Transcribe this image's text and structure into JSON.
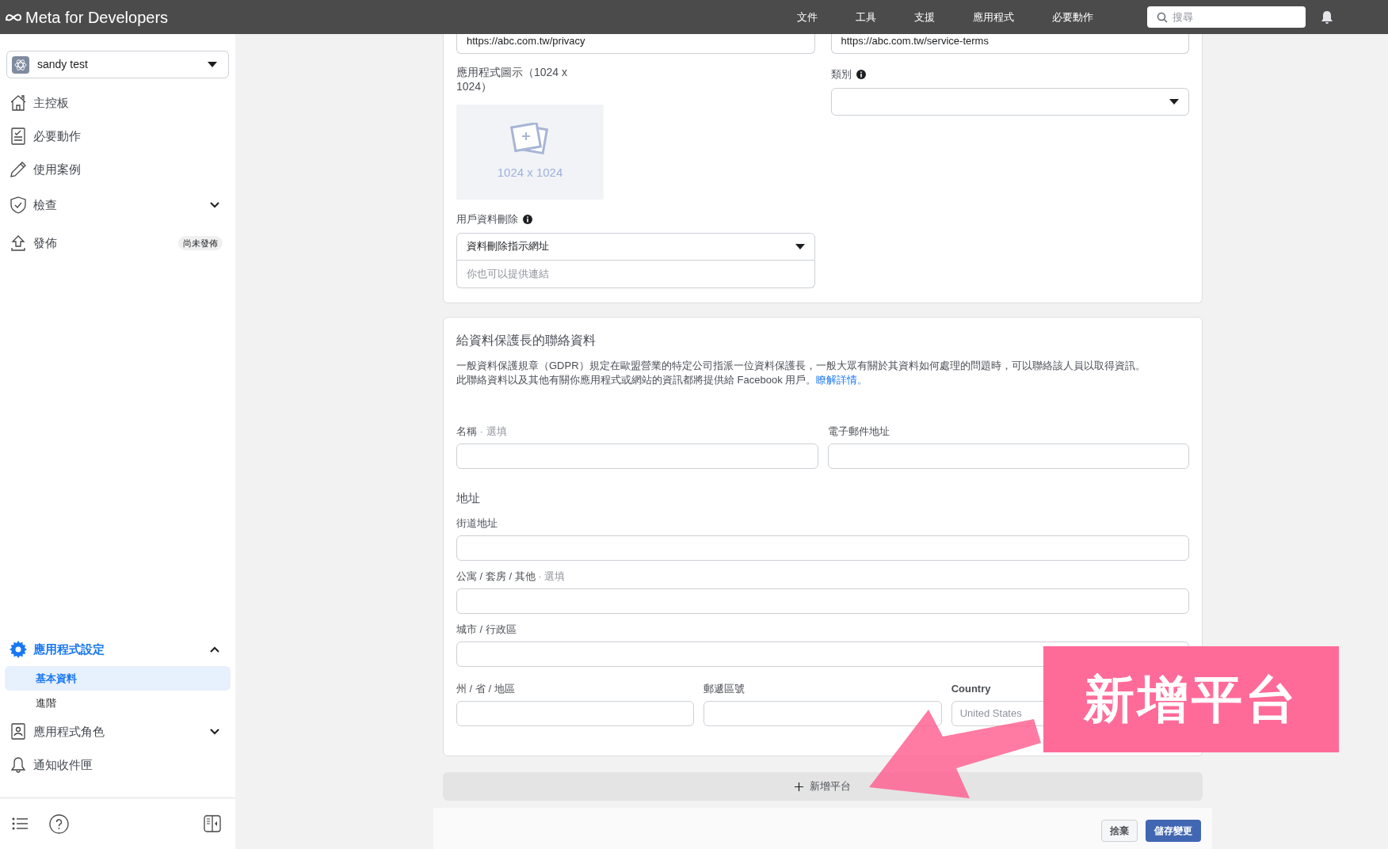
{
  "top_bar": {
    "logo": "Meta for Developers",
    "nav": [
      "文件",
      "工具",
      "支援",
      "應用程式",
      "必要動作"
    ],
    "search": {
      "placeholder": "搜尋"
    }
  },
  "sidebar": {
    "app_selector": "sandy test",
    "items": [
      {
        "label": "主控板",
        "selected": false
      },
      {
        "label": "必要動作",
        "selected": false
      },
      {
        "label": "使用案例",
        "selected": false
      },
      {
        "label": "檢查",
        "selected": false,
        "expanded": false
      },
      {
        "label": "發佈",
        "selected": false,
        "badge": "尚未發佈"
      }
    ],
    "bottom_items": [
      {
        "label": "應用程式設定",
        "selected": true,
        "expanded": true,
        "children": [
          {
            "label": "基本資料",
            "selected": true
          },
          {
            "label": "進階",
            "selected": false
          }
        ]
      },
      {
        "label": "應用程式角色",
        "selected": false,
        "expanded": false
      },
      {
        "label": "通知收件匣",
        "selected": false
      }
    ]
  },
  "basic_card": {
    "privacy_url": "https://abc.com.tw/privacy",
    "terms_url": "https://abc.com.tw/service-terms",
    "app_icon": {
      "label": "應用程式圖示（1024 x 1024）",
      "hint": "1024 x 1024"
    },
    "category": {
      "label": "類別"
    },
    "data_deletion": {
      "label": "用戶資料刪除",
      "select_value": "資料刪除指示網址",
      "url_placeholder": "你也可以提供連結"
    }
  },
  "dpo_card": {
    "title": "給資料保護長的聯絡資料",
    "paragraphs": [
      "一般資料保護規章（GDPR）規定在歐盟營業的特定公司指派一位資料保護長，一般大眾有關於其資料如何處理的問題時，可以聯絡該人員以取得資訊。",
      "此聯絡資料以及其他有關你應用程式或網站的資訊都將提供給 Facebook 用戶。"
    ],
    "link": "瞭解詳情。",
    "name": {
      "label": "名稱",
      "optional": "· 選填"
    },
    "email": {
      "label": "電子郵件地址"
    },
    "address_heading": "地址",
    "street": {
      "label": "街道地址"
    },
    "apartment": {
      "label": "公寓 / 套房 / 其他",
      "optional": "· 選填"
    },
    "city": {
      "label": "城市 / 行政區"
    },
    "state": {
      "label": "州 / 省 / 地區"
    },
    "zip": {
      "label": "郵遞區號"
    },
    "country": {
      "label": "Country",
      "value": "United States"
    }
  },
  "add_platform": "新增平台",
  "footer": {
    "discard": "捨棄",
    "save": "儲存變更"
  },
  "annotation": {
    "text": "新增平台"
  }
}
